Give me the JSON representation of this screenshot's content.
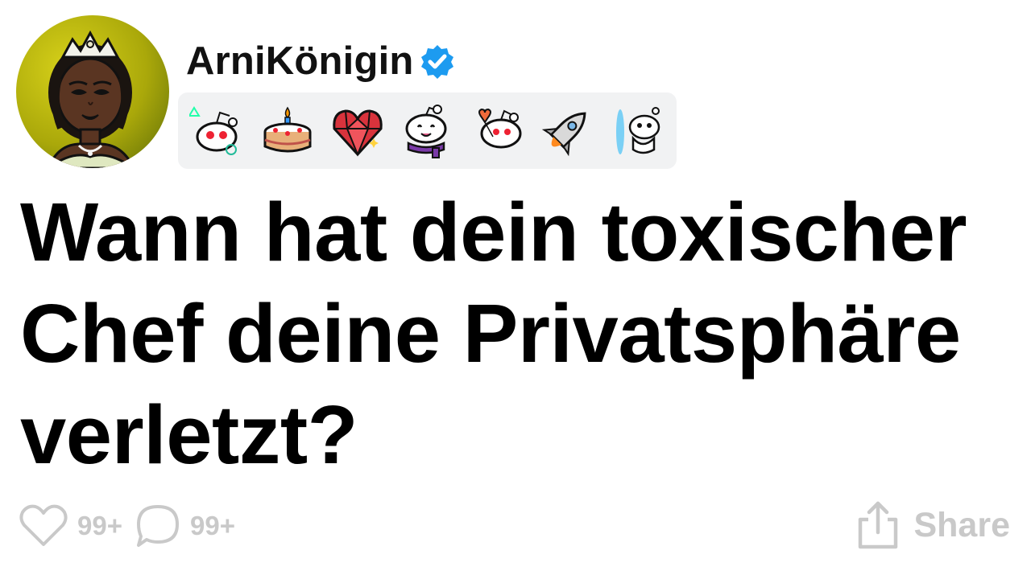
{
  "post": {
    "author": {
      "username": "ArniKönigin",
      "verified": true,
      "avatar_icon": "princess-avatar-icon"
    },
    "award_badges": [
      "reddit-snoo-shapes-icon",
      "birthday-cake-icon",
      "gem-heart-icon",
      "snoo-scarf-tongue-icon",
      "snoo-heart-balloons-icon",
      "rocket-icon",
      "snoo-portal-icon"
    ],
    "title": "Wann hat dein toxischer Chef deine Privatsphäre verletzt?",
    "likes_count": "99+",
    "comments_count": "99+",
    "share_label": "Share"
  },
  "colors": {
    "verified_blue": "#1d9bf0",
    "muted_gray": "#c9c9c9",
    "badge_bg": "#f1f2f3",
    "title_black": "#000000"
  }
}
